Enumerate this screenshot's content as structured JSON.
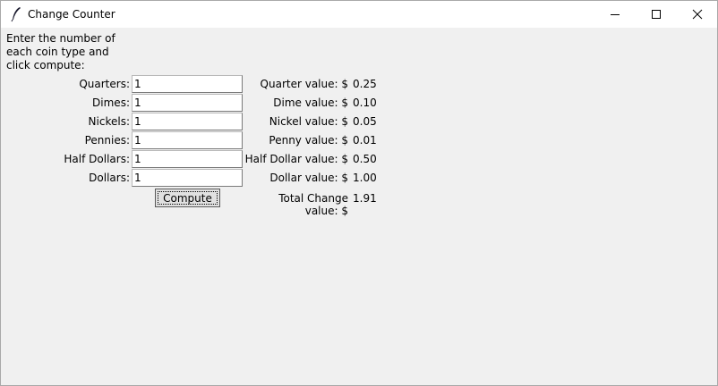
{
  "window": {
    "title": "Change Counter"
  },
  "instructions": "Enter the number of each coin type and click compute:",
  "fields": [
    {
      "label": "Quarters:",
      "value": "1"
    },
    {
      "label": "Dimes:",
      "value": "1"
    },
    {
      "label": "Nickels:",
      "value": "1"
    },
    {
      "label": "Pennies:",
      "value": "1"
    },
    {
      "label": "Half Dollars:",
      "value": "1"
    },
    {
      "label": "Dollars:",
      "value": "1"
    }
  ],
  "values": [
    {
      "label": "Quarter value: $",
      "amount": "0.25"
    },
    {
      "label": "Dime value: $",
      "amount": "0.10"
    },
    {
      "label": "Nickel value: $",
      "amount": "0.05"
    },
    {
      "label": "Penny value: $",
      "amount": "0.01"
    },
    {
      "label": "Half Dollar value: $",
      "amount": "0.50"
    },
    {
      "label": "Dollar value: $",
      "amount": "1.00"
    }
  ],
  "total": {
    "label": "Total Change value: $",
    "amount": "1.91"
  },
  "compute_label": "Compute"
}
